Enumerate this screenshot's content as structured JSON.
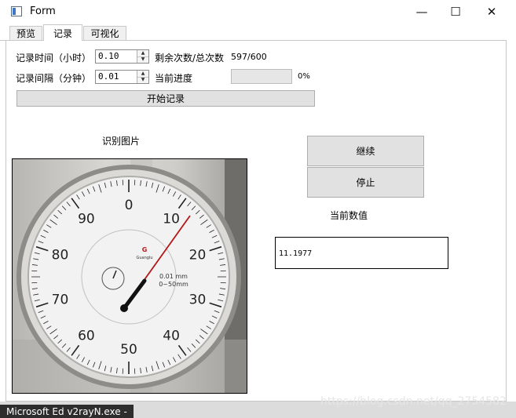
{
  "window": {
    "title": "Form",
    "minimize_glyph": "—",
    "maximize_glyph": "☐",
    "close_glyph": "✕"
  },
  "tabs": [
    {
      "label": "预览",
      "active": false
    },
    {
      "label": "记录",
      "active": true
    },
    {
      "label": "可视化",
      "active": false
    }
  ],
  "record": {
    "interval_hours_label": "记录时间（小时）",
    "interval_hours_value": "0.10",
    "remaining_label": "剩余次数/总次数",
    "remaining_value": "597/600",
    "interval_minutes_label": "记录间隔（分钟）",
    "interval_minutes_value": "0.01",
    "progress_label": "当前进度",
    "progress_value": 0,
    "progress_text": "0%",
    "start_button": "开始记录"
  },
  "recognition": {
    "image_label": "识别图片",
    "continue_button": "继续",
    "stop_button": "停止",
    "current_value_label": "当前数值",
    "current_value": "11.1977"
  },
  "gauge": {
    "brand": "Guanglu",
    "spec_line1": "0.01 mm",
    "spec_line2": "0~50mm",
    "dial_numbers": [
      "0",
      "10",
      "20",
      "30",
      "40",
      "50",
      "60",
      "70",
      "80",
      "90"
    ]
  },
  "taskbar": {
    "text": "Microsoft Ed  v2rayN.exe -"
  },
  "watermark": "https://blog.csdn.net/qq_2754582"
}
